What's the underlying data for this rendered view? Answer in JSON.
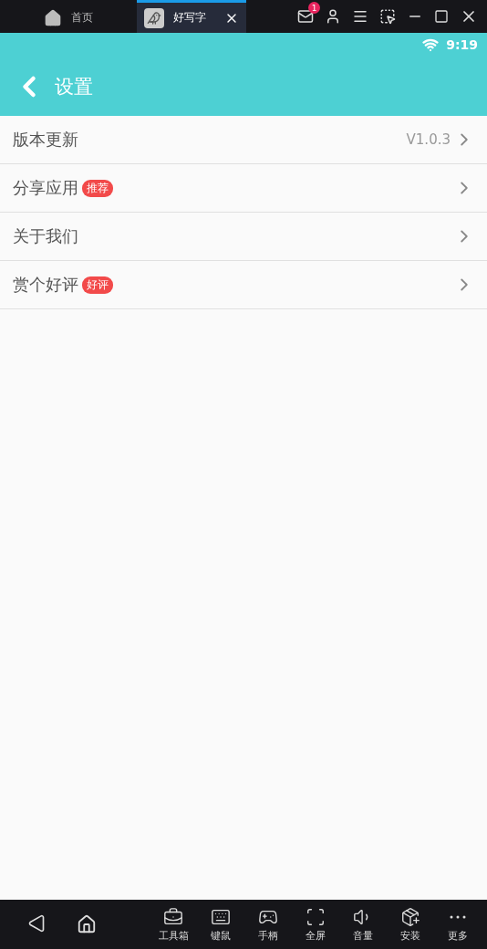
{
  "emulator_tabs": [
    {
      "label": "首页",
      "kind": "home",
      "selected": false
    },
    {
      "label": "好写字",
      "kind": "app",
      "selected": true
    }
  ],
  "mail_badge": "1",
  "status_bar": {
    "time": "9:19"
  },
  "app_bar": {
    "title": "设置"
  },
  "settings": [
    {
      "label": "版本更新",
      "value": "V1.0.3"
    },
    {
      "label": "分享应用",
      "tag": "推荐"
    },
    {
      "label": "关于我们"
    },
    {
      "label": "赏个好评",
      "tag": "好评"
    }
  ],
  "toolbar": [
    {
      "label": "工具箱",
      "kind": "toolbox"
    },
    {
      "label": "键鼠",
      "kind": "keyboard"
    },
    {
      "label": "手柄",
      "kind": "gamepad"
    },
    {
      "label": "全屏",
      "kind": "fullscreen"
    },
    {
      "label": "音量",
      "kind": "volume"
    },
    {
      "label": "安装",
      "kind": "apk"
    },
    {
      "label": "更多",
      "kind": "more"
    }
  ]
}
